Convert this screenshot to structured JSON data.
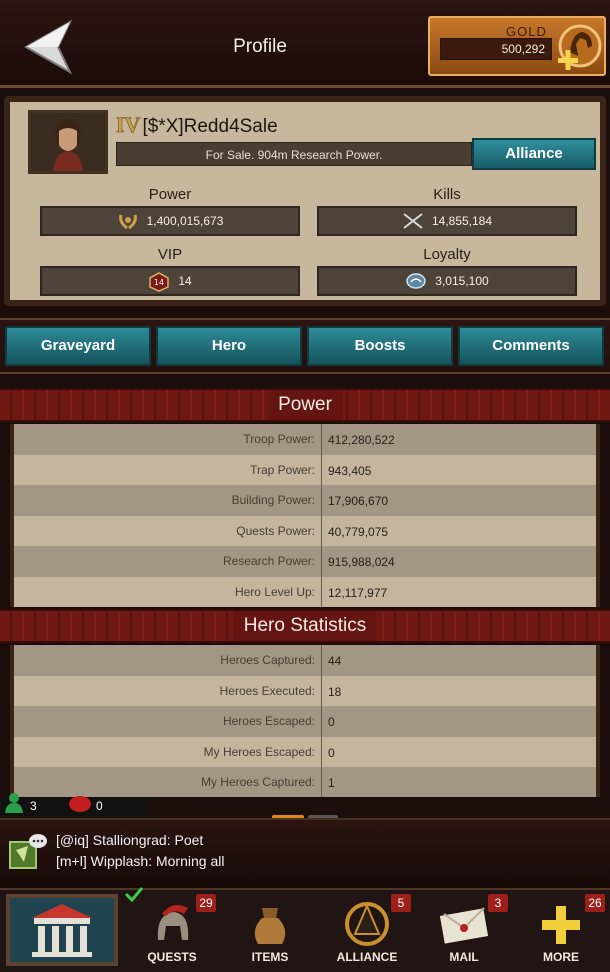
{
  "header": {
    "title": "Profile",
    "gold_label": "GOLD",
    "gold_value": "500,292"
  },
  "profile": {
    "rank": "IV",
    "name": "[$*X]Redd4Sale",
    "motto": "For Sale. 904m Research Power.",
    "alliance_button": "Alliance",
    "stats": {
      "power_label": "Power",
      "power_value": "1,400,015,673",
      "kills_label": "Kills",
      "kills_value": "14,855,184",
      "vip_label": "VIP",
      "vip_value": "14",
      "loyalty_label": "Loyalty",
      "loyalty_value": "3,015,100"
    }
  },
  "tabs": [
    "Graveyard",
    "Hero",
    "Boosts",
    "Comments"
  ],
  "power_section": {
    "title": "Power",
    "rows": [
      {
        "label": "Troop Power:",
        "value": "412,280,522"
      },
      {
        "label": "Trap Power:",
        "value": "943,405"
      },
      {
        "label": "Building Power:",
        "value": "17,906,670"
      },
      {
        "label": "Quests Power:",
        "value": "40,779,075"
      },
      {
        "label": "Research Power:",
        "value": "915,988,024"
      },
      {
        "label": "Hero Level Up:",
        "value": "12,117,977"
      }
    ]
  },
  "hero_section": {
    "title": "Hero Statistics",
    "rows": [
      {
        "label": "Heroes Captured:",
        "value": "44"
      },
      {
        "label": "Heroes Executed:",
        "value": "18"
      },
      {
        "label": "Heroes Escaped:",
        "value": "0"
      },
      {
        "label": "My Heroes Escaped:",
        "value": "0"
      },
      {
        "label": "My Heroes Captured:",
        "value": "1"
      }
    ]
  },
  "status": {
    "online_count": "3",
    "alert_count": "0"
  },
  "chat": {
    "lines": [
      "[@iq] Stalliongrad: Poet",
      "[m+l] Wipplash: Morning all"
    ]
  },
  "nav": {
    "items": [
      {
        "label": "QUESTS",
        "badge": "29",
        "icon": "helmet-icon"
      },
      {
        "label": "ITEMS",
        "badge": "",
        "icon": "bag-icon"
      },
      {
        "label": "ALLIANCE",
        "badge": "5",
        "icon": "alliance-emblem-icon"
      },
      {
        "label": "MAIL",
        "badge": "3",
        "icon": "mail-icon"
      },
      {
        "label": "MORE",
        "badge": "26",
        "icon": "plus-icon"
      }
    ]
  },
  "colors": {
    "accent_teal": "#2d8a95",
    "section_red": "#6e1814",
    "gold": "#c7782b",
    "badge_red": "#9c1f1a"
  }
}
